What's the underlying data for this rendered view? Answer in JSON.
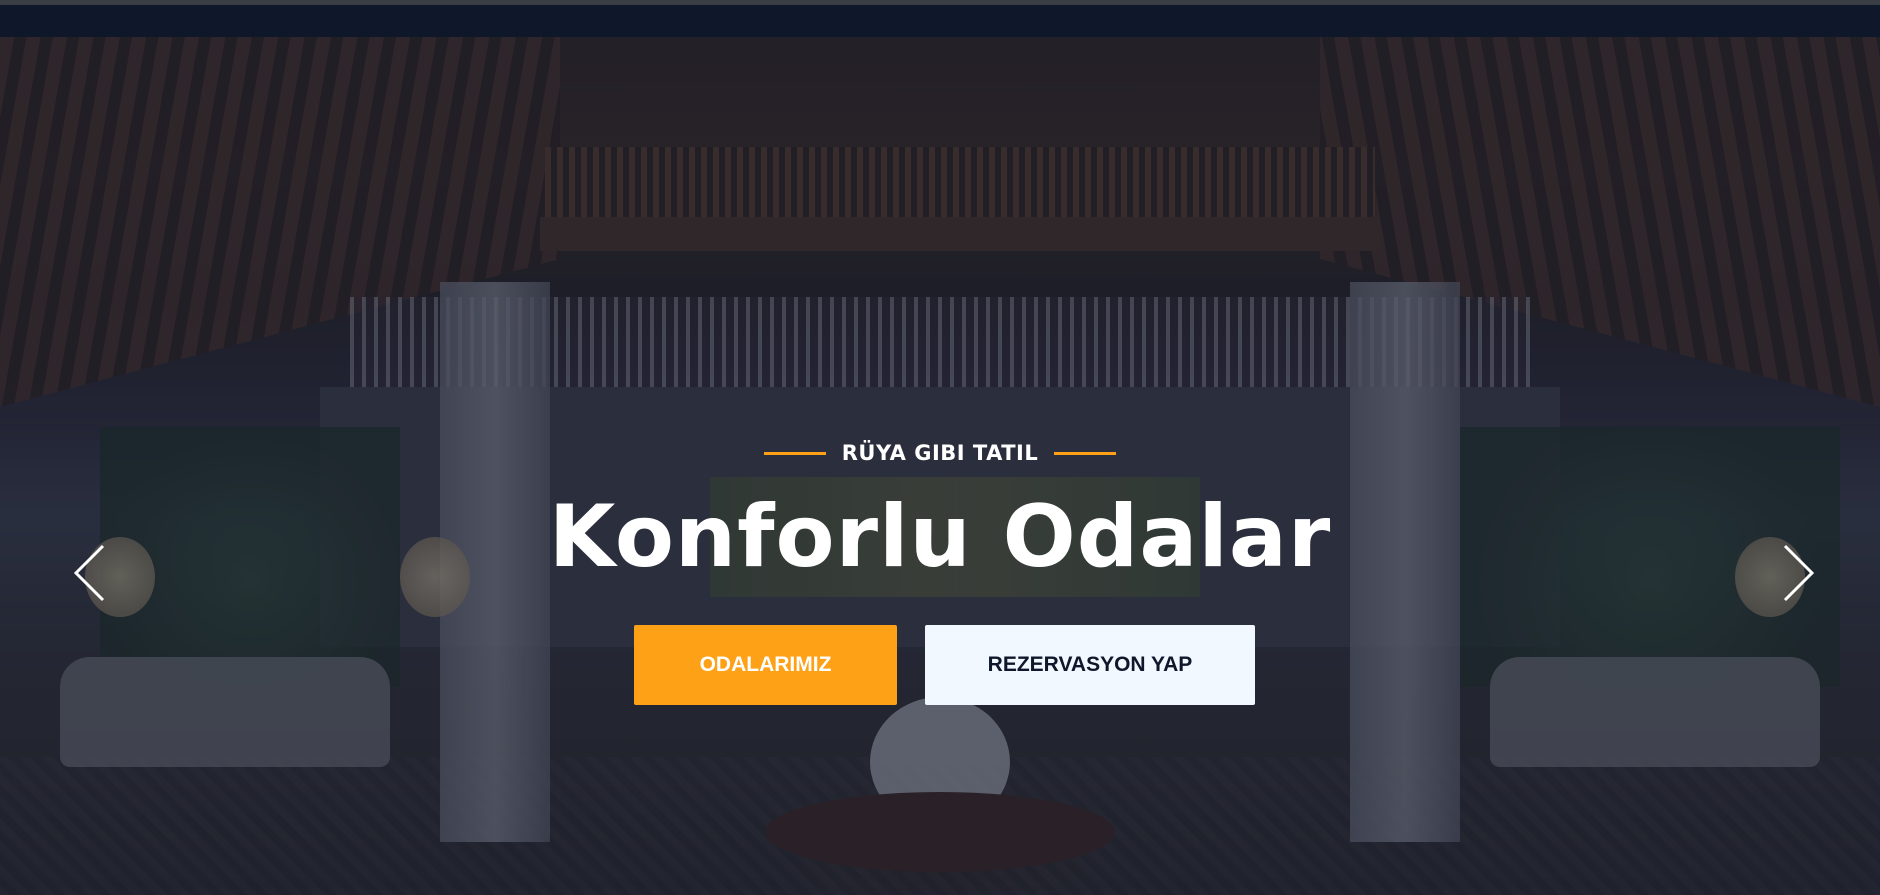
{
  "hero": {
    "subtitle": "RÜYA GIBI TATIL",
    "title": "Konforlu Odalar",
    "buttons": {
      "primary_label": "ODALARIMIZ",
      "secondary_label": "REZERVASYON YAP"
    }
  },
  "carousel": {
    "prev_icon": "chevron-left-icon",
    "next_icon": "chevron-right-icon"
  },
  "colors": {
    "accent": "#fea116",
    "dark": "#0f172b",
    "light_button": "#f1f8ff",
    "text": "#ffffff"
  }
}
